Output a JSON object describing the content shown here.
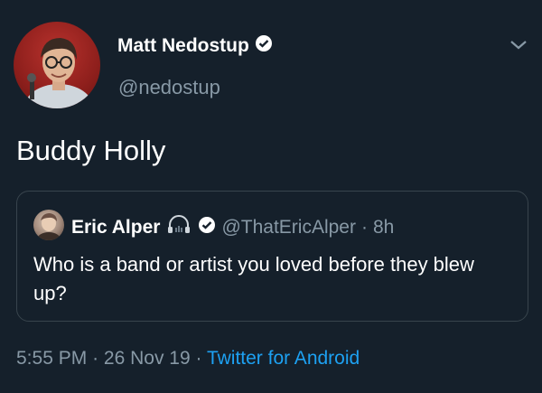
{
  "tweet": {
    "author_name": "Matt Nedostup",
    "author_handle": "@nedostup",
    "text": "Buddy Holly",
    "time": "5:55 PM",
    "separator": "·",
    "date": "26 Nov 19",
    "source": "Twitter for Android"
  },
  "quoted_tweet": {
    "author_name": "Eric Alper",
    "author_handle": "@ThatEricAlper",
    "separator": "·",
    "age": "8h",
    "text": "Who is a band or artist you loved before they blew up?"
  },
  "icons": {
    "verified": "verified-badge-icon",
    "menu": "chevron-down-icon",
    "headphones": "headphones-icon"
  },
  "colors": {
    "background": "#15202b",
    "secondary_text": "#8899a6",
    "link": "#1da1f2",
    "border": "#38444d"
  }
}
